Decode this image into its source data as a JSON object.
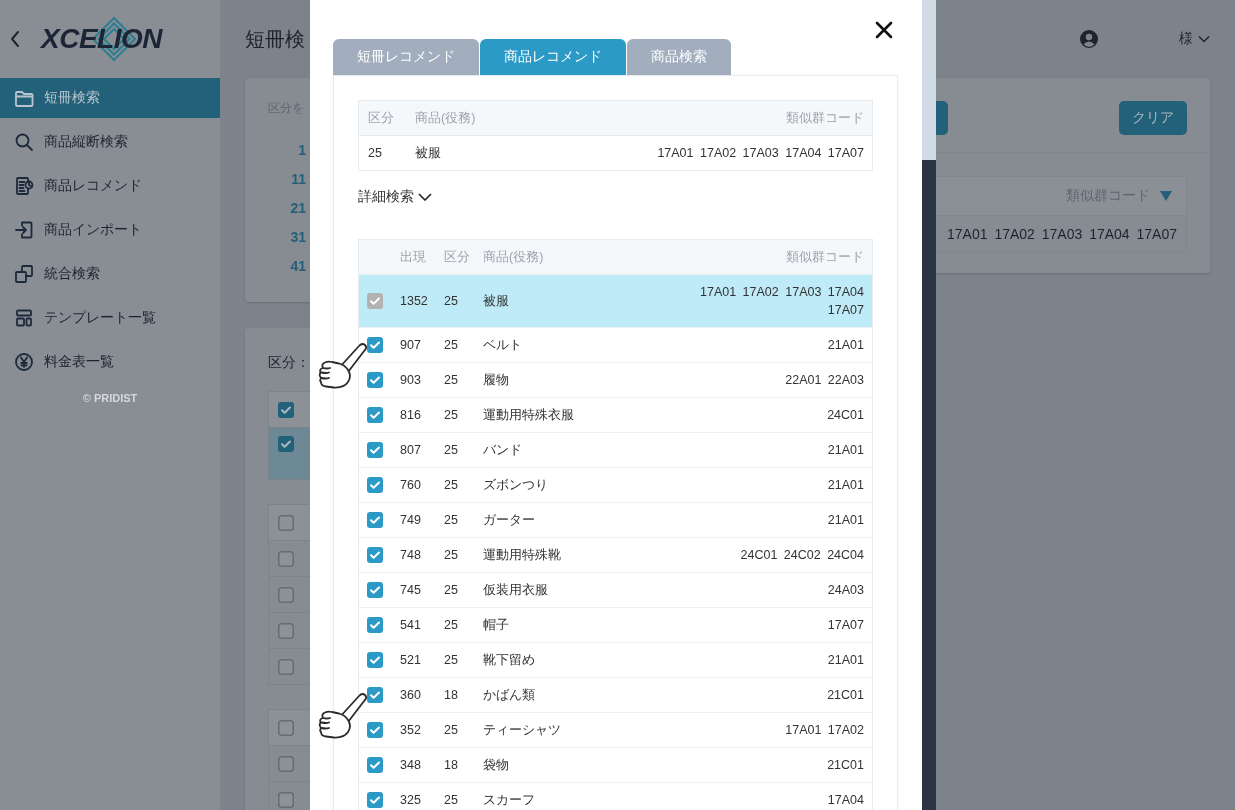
{
  "sidebar": {
    "logo": "XCELION",
    "items": [
      {
        "label": "短冊検索",
        "selected": true
      },
      {
        "label": "商品縦断検索",
        "selected": false
      },
      {
        "label": "商品レコメンド",
        "selected": false
      },
      {
        "label": "商品インポート",
        "selected": false
      },
      {
        "label": "統合検索",
        "selected": false
      },
      {
        "label": "テンプレート一覧",
        "selected": false
      },
      {
        "label": "料金表一覧",
        "selected": false
      }
    ],
    "footer": "© PRIDIST"
  },
  "header": {
    "title": "短冊検",
    "user": "様"
  },
  "class_picker": {
    "hint": "区分を",
    "ranges": [
      "1",
      "11",
      "21",
      "31",
      "41"
    ]
  },
  "class_list": {
    "label": "区分：",
    "groups": [
      {
        "checked": true,
        "rows": [
          {
            "checked": true,
            "selected": true
          }
        ]
      },
      {
        "checked": false,
        "rows": [
          {
            "checked": false,
            "selected": false
          },
          {
            "checked": false,
            "selected": false
          },
          {
            "checked": false,
            "selected": false
          },
          {
            "checked": false,
            "selected": false
          }
        ]
      },
      {
        "checked": false,
        "rows": [
          {
            "checked": false,
            "selected": false
          },
          {
            "checked": false,
            "selected": false
          }
        ]
      }
    ]
  },
  "result_card": {
    "clear_button": "クリア",
    "table": {
      "column": "類似群コード",
      "rows": [
        {
          "codes": "17A01 17A02 17A03 17A04 17A07"
        }
      ]
    }
  },
  "modal": {
    "tabs": [
      {
        "label": "短冊レコメンド",
        "selected": false
      },
      {
        "label": "商品レコメンド",
        "selected": true
      },
      {
        "label": "商品検索",
        "selected": false
      }
    ],
    "query": {
      "columns": [
        "区分",
        "商品(役務)",
        "類似群コード"
      ],
      "rows": [
        {
          "class": "25",
          "goods": "被服",
          "codes": "17A01 17A02 17A03 17A04 17A07"
        }
      ]
    },
    "detail_toggle": {
      "label": "詳細検索",
      "expanded": false
    },
    "results": {
      "columns": [
        "出現",
        "区分",
        "商品(役務)",
        "類似群コード"
      ],
      "rows": [
        {
          "count": "1352",
          "class": "25",
          "goods": "被服",
          "codes": "17A01 17A02 17A03 17A04 17A07",
          "checked": true,
          "disabled": true,
          "selected": true,
          "pointed": false
        },
        {
          "count": "907",
          "class": "25",
          "goods": "ベルト",
          "codes": "21A01",
          "checked": true,
          "disabled": false,
          "selected": false,
          "pointed": true
        },
        {
          "count": "903",
          "class": "25",
          "goods": "履物",
          "codes": "22A01 22A03",
          "checked": true,
          "disabled": false,
          "selected": false,
          "pointed": false
        },
        {
          "count": "816",
          "class": "25",
          "goods": "運動用特殊衣服",
          "codes": "24C01",
          "checked": true,
          "disabled": false,
          "selected": false,
          "pointed": false
        },
        {
          "count": "807",
          "class": "25",
          "goods": "バンド",
          "codes": "21A01",
          "checked": true,
          "disabled": false,
          "selected": false,
          "pointed": false
        },
        {
          "count": "760",
          "class": "25",
          "goods": "ズボンつり",
          "codes": "21A01",
          "checked": true,
          "disabled": false,
          "selected": false,
          "pointed": false
        },
        {
          "count": "749",
          "class": "25",
          "goods": "ガーター",
          "codes": "21A01",
          "checked": true,
          "disabled": false,
          "selected": false,
          "pointed": false
        },
        {
          "count": "748",
          "class": "25",
          "goods": "運動用特殊靴",
          "codes": "24C01 24C02 24C04",
          "checked": true,
          "disabled": false,
          "selected": false,
          "pointed": false
        },
        {
          "count": "745",
          "class": "25",
          "goods": "仮装用衣服",
          "codes": "24A03",
          "checked": true,
          "disabled": false,
          "selected": false,
          "pointed": false
        },
        {
          "count": "541",
          "class": "25",
          "goods": "帽子",
          "codes": "17A07",
          "checked": true,
          "disabled": false,
          "selected": false,
          "pointed": false
        },
        {
          "count": "521",
          "class": "25",
          "goods": "靴下留め",
          "codes": "21A01",
          "checked": true,
          "disabled": false,
          "selected": false,
          "pointed": false
        },
        {
          "count": "360",
          "class": "18",
          "goods": "かばん類",
          "codes": "21C01",
          "checked": true,
          "disabled": false,
          "selected": false,
          "pointed": true
        },
        {
          "count": "352",
          "class": "25",
          "goods": "ティーシャツ",
          "codes": "17A01 17A02",
          "checked": true,
          "disabled": false,
          "selected": false,
          "pointed": false
        },
        {
          "count": "348",
          "class": "18",
          "goods": "袋物",
          "codes": "21C01",
          "checked": true,
          "disabled": false,
          "selected": false,
          "pointed": false
        },
        {
          "count": "325",
          "class": "25",
          "goods": "スカーフ",
          "codes": "17A04",
          "checked": true,
          "disabled": false,
          "selected": false,
          "pointed": false
        }
      ]
    }
  }
}
